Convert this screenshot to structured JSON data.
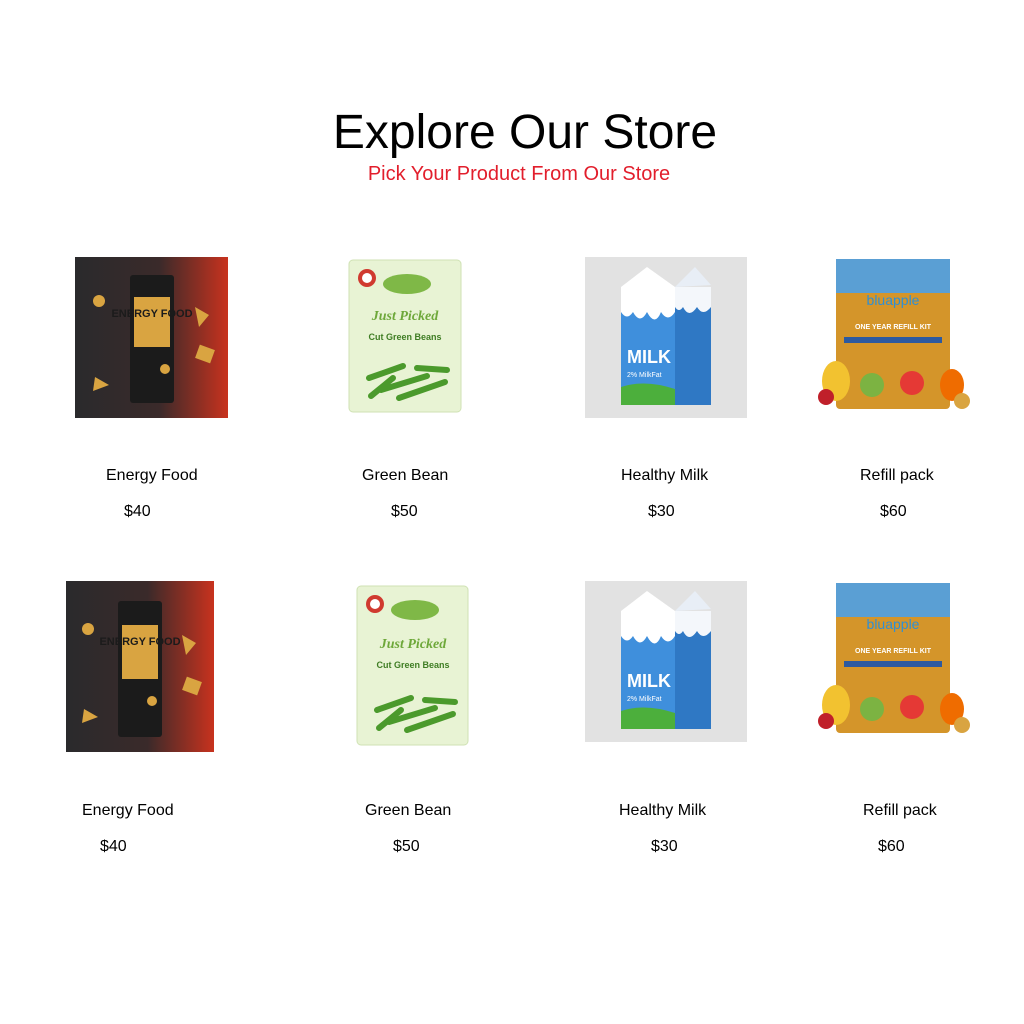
{
  "header": {
    "title": "Explore Our Store",
    "subtitle": "Pick Your Product From Our Store",
    "subtitle_color": "#e21e2c"
  },
  "products": [
    {
      "name": "Energy Food",
      "price": "$40",
      "icon": "energy-food-pack",
      "label": "ENERGY FOOD"
    },
    {
      "name": "Green Bean",
      "price": "$50",
      "icon": "green-bean-bag",
      "label": "Cut Green Beans"
    },
    {
      "name": "Healthy Milk",
      "price": "$30",
      "icon": "milk-carton",
      "label": "MILK",
      "sub_label": "2% MilkFat"
    },
    {
      "name": "Refill pack",
      "price": "$60",
      "icon": "refill-pouch",
      "label": "bluapple",
      "sub_label": "ONE YEAR REFILL KIT"
    },
    {
      "name": "Energy Food",
      "price": "$40",
      "icon": "energy-food-pack",
      "label": "ENERGY FOOD"
    },
    {
      "name": "Green Bean",
      "price": "$50",
      "icon": "green-bean-bag",
      "label": "Cut Green Beans"
    },
    {
      "name": "Healthy Milk",
      "price": "$30",
      "icon": "milk-carton",
      "label": "MILK",
      "sub_label": "2% MilkFat"
    },
    {
      "name": "Refill pack",
      "price": "$60",
      "icon": "refill-pouch",
      "label": "bluapple",
      "sub_label": "ONE YEAR REFILL KIT"
    }
  ]
}
